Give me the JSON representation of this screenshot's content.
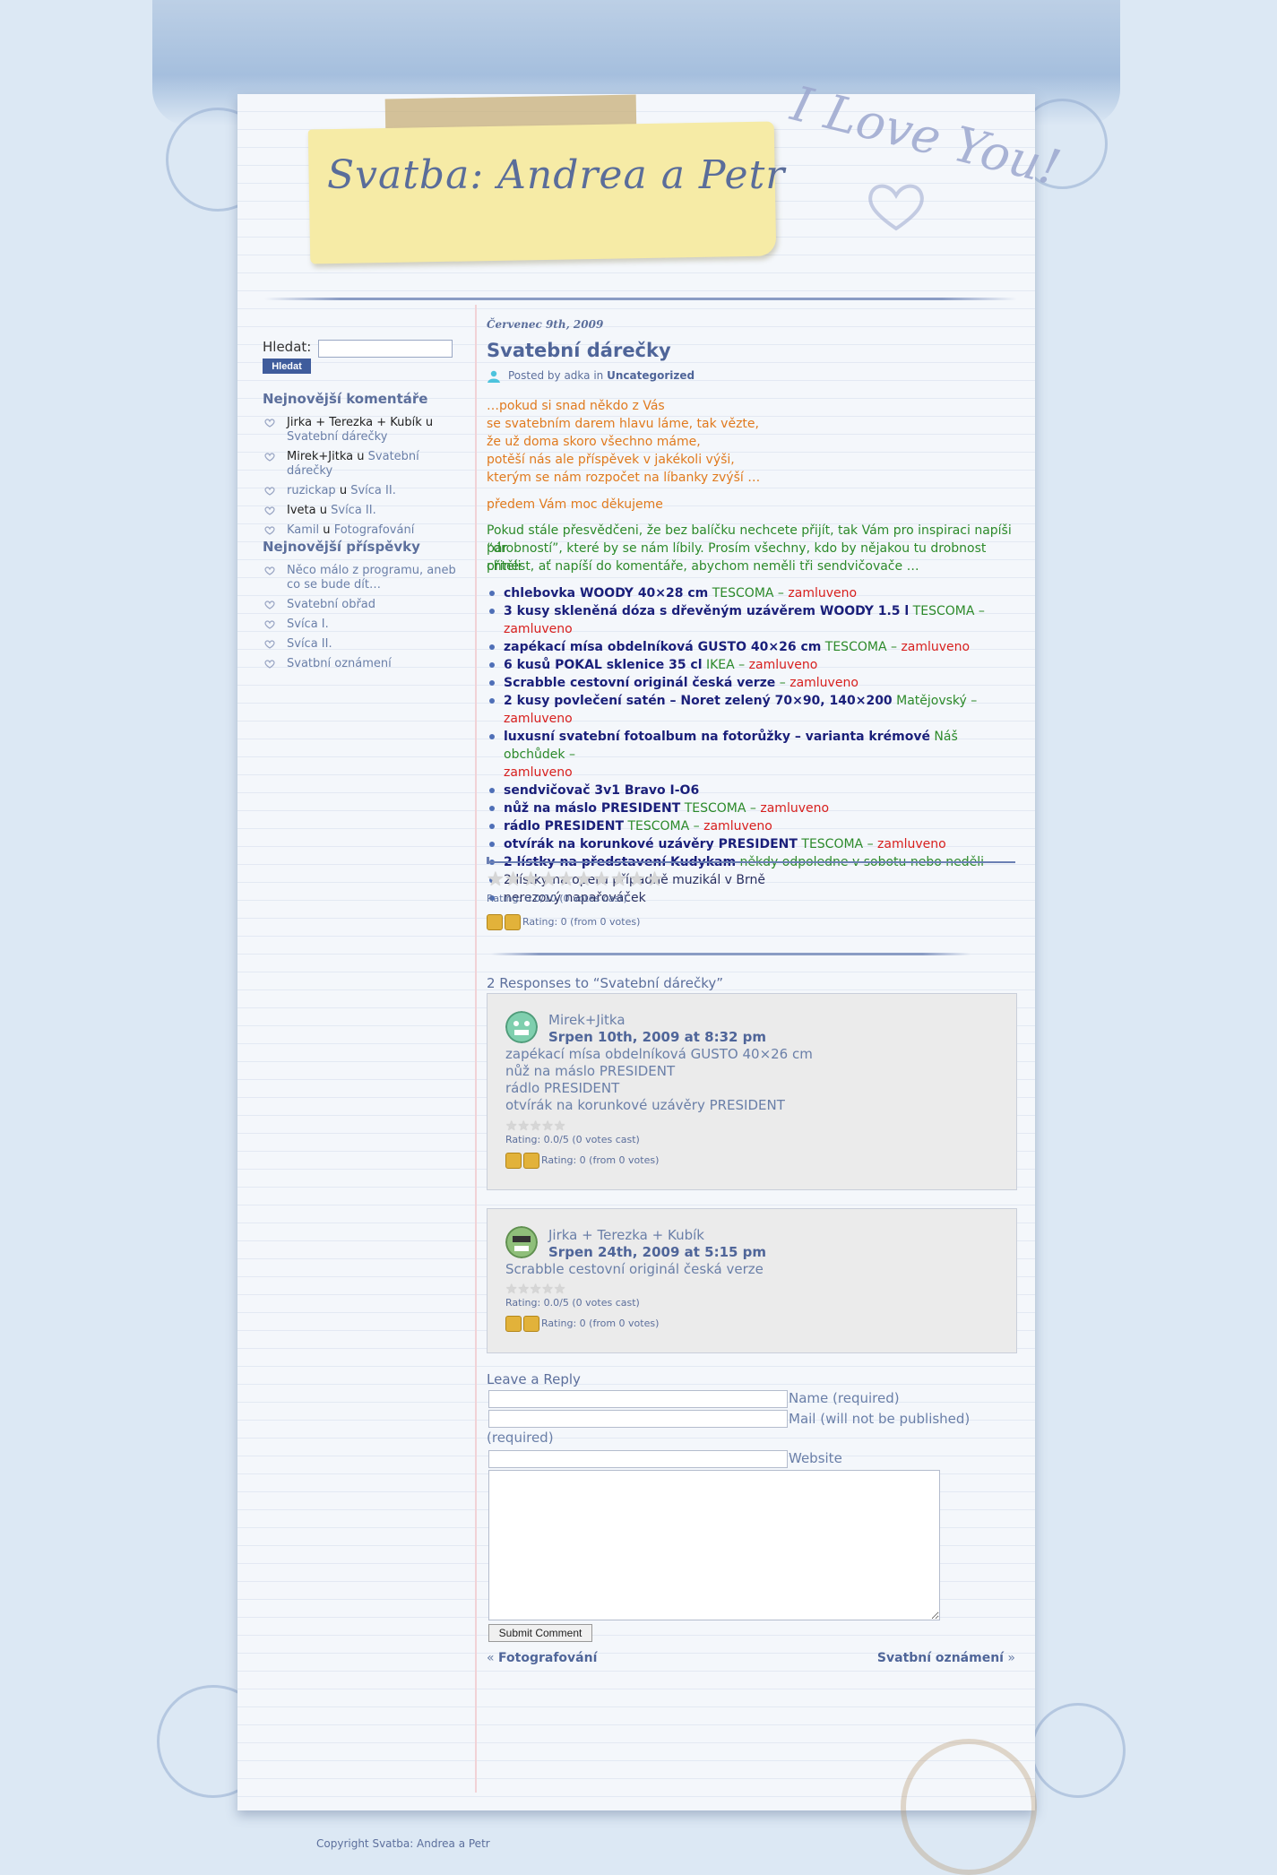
{
  "blog": {
    "title": "Svatba: Andrea a Petr",
    "love_text": "I Love You!"
  },
  "search": {
    "label": "Hledat:",
    "button": "Hledat",
    "value": ""
  },
  "sidebar": {
    "recent_comments_title": "Nejnovější komentáře",
    "recent_comments": [
      {
        "author": "Jirka + Terezka + Kubík",
        "sep": "u",
        "post": "Svatební dárečky"
      },
      {
        "author": "Mirek+Jitka",
        "sep": "u",
        "post": "Svatební dárečky"
      },
      {
        "author": "ruzickap",
        "sep": "u",
        "post": "Svíca II."
      },
      {
        "author": "Iveta",
        "sep": "u",
        "post": "Svíca II."
      },
      {
        "author": "Kamil",
        "sep": "u",
        "post": "Fotografování"
      }
    ],
    "recent_posts_title": "Nejnovější příspěvky",
    "recent_posts": [
      "Něco málo z programu, aneb co se bude dít…",
      "Svatební obřad",
      "Svíca I.",
      "Svíca II.",
      "Svatbní oznámení"
    ]
  },
  "post": {
    "date": "Červenec 9th, 2009",
    "title": "Svatební dárečky",
    "meta_prefix": "Posted by adka in",
    "category": "Uncategorized",
    "poem": [
      "…pokud si snad někdo z Vás",
      "se svatebním darem hlavu láme, tak vězte,",
      "že už doma skoro všechno máme,",
      "potěší nás ale příspěvek v jakékoli výši,",
      "kterým se nám rozpočet na líbanky zvýší …"
    ],
    "thanks": "předem Vám moc děkujeme",
    "intro": [
      "Pokud stále přesvědčeni, že bez balíčku nechcete přijít, tak Vám pro inspiraci napíši pár",
      "“drobností”, které by se nám líbily. Prosím všechny, kdo by nějakou tu drobnost chtěli",
      "přinést, ať napíší do komentáře, abychom neměli tři sendvičovače …"
    ],
    "gifts": [
      {
        "item": "chlebovka WOODY 40×28 cm",
        "shop": "TESCOMA",
        "dash": " – ",
        "status": "zamluveno"
      },
      {
        "item": "3 kusy skleněná dóza s dřevěným uzávěrem WOODY 1.5 l",
        "shop": "TESCOMA",
        "dash": " – ",
        "status": "zamluveno"
      },
      {
        "item": "zapékací mísa obdelníková GUSTO 40×26 cm",
        "shop": "TESCOMA",
        "dash": " – ",
        "status": "zamluveno"
      },
      {
        "item": "6 kusů POKAL sklenice 35 cl",
        "shop": "IKEA",
        "dash": " – ",
        "status": "zamluveno"
      },
      {
        "item": "Scrabble cestovní originál česká verze",
        "shop": "",
        "dash": " – ",
        "status": "zamluveno"
      },
      {
        "item": "2 kusy povlečení satén – Noret zelený 70×90, 140×200",
        "shop": "Matějovský",
        "dash": " – ",
        "status": "zamluveno"
      },
      {
        "item": "luxusní svatební fotoalbum na fotorůžky – varianta krémové",
        "shop": "Náš obchůdek –",
        "dash": " ",
        "status": "zamluveno"
      },
      {
        "item": "sendvičovač 3v1 Bravo I-O6",
        "shop": "",
        "dash": "",
        "status": ""
      },
      {
        "item": "nůž na máslo PRESIDENT",
        "shop": "TESCOMA",
        "dash": " – ",
        "status": "zamluveno"
      },
      {
        "item": "rádlo PRESIDENT",
        "shop": "TESCOMA",
        "dash": " – ",
        "status": "zamluveno"
      },
      {
        "item": "otvírák na korunkové uzávěry PRESIDENT",
        "shop": "TESCOMA",
        "dash": " – ",
        "status": "zamluveno"
      },
      {
        "item": "2 lístky na představení Kudykam",
        "shop": "někdy odpoledne v sobotu nebo neděli",
        "dash": "",
        "status": ""
      },
      {
        "item": "",
        "shop": "",
        "dash": "",
        "status": "",
        "plain": "2 lístky na operu případně muzikál v Brně"
      },
      {
        "item": "",
        "shop": "",
        "dash": "",
        "status": "",
        "plain": "nerezový napařováček"
      }
    ],
    "rating_stars": 10,
    "rating_text": "Rating: 0.0/10 (0 votes cast)",
    "thumbs_text": "Rating: 0 (from 0 votes)"
  },
  "responses": {
    "heading": "2 Responses to “Svatební dárečky”",
    "comments": [
      {
        "author": "Mirek+Jitka",
        "date": "Srpen 10th, 2009 at 8:32 pm",
        "lines": [
          "zapékací mísa obdelníková GUSTO 40×26 cm",
          "nůž na máslo PRESIDENT",
          "rádlo PRESIDENT",
          "otvírák na korunkové uzávěry PRESIDENT"
        ],
        "rating_text": "Rating: 0.0/5 (0 votes cast)",
        "thumbs_text": "Rating: 0 (from 0 votes)"
      },
      {
        "author": "Jirka + Terezka + Kubík",
        "date": "Srpen 24th, 2009 at 5:15 pm",
        "lines": [
          "Scrabble cestovní originál česká verze"
        ],
        "rating_text": "Rating: 0.0/5 (0 votes cast)",
        "thumbs_text": "Rating: 0 (from 0 votes)"
      }
    ]
  },
  "reply": {
    "heading": "Leave a Reply",
    "name_label": "Name (required)",
    "mail_label_1": "Mail (will not be published)",
    "mail_label_2": "(required)",
    "website_label": "Website",
    "submit": "Submit Comment"
  },
  "navigation": {
    "prev_arrow": "«",
    "prev": "Fotografování",
    "next": "Svatbní oznámení",
    "next_arrow": "»"
  },
  "footer": {
    "copyright": "Copyright Svatba: Andrea a Petr"
  },
  "colors": {
    "accent": "#4f6599",
    "orange": "#e07a1e",
    "green": "#2c8a2a",
    "red": "#d8201e",
    "navy": "#1a1f7a",
    "page": "#f4f7fb",
    "background": "#dce8f4"
  }
}
